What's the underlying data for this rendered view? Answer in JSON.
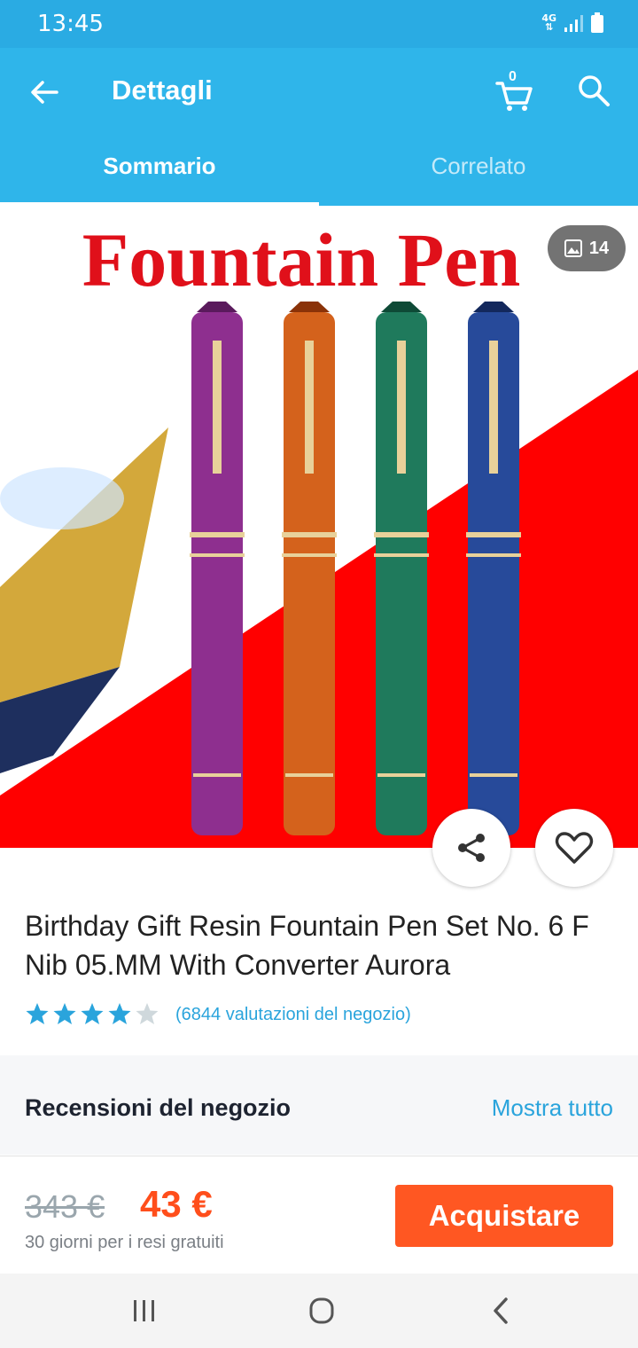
{
  "status_bar": {
    "time": "13:45",
    "network": "4G"
  },
  "header": {
    "title": "Dettagli",
    "cart_count": "0",
    "tabs": [
      {
        "label": "Sommario",
        "active": true
      },
      {
        "label": "Correlato",
        "active": false
      }
    ]
  },
  "gallery": {
    "banner_text": "Fountain Pen",
    "photo_count": "14",
    "pen_colors": [
      "#8e2f8f",
      "#d4621c",
      "#1f7a5c",
      "#274a9a"
    ]
  },
  "product": {
    "title": "Birthday Gift Resin Fountain Pen Set No. 6 F Nib 05.MM With Converter Aurora",
    "rating": 4.5,
    "rating_text": "(6844 valutazioni del negozio)"
  },
  "reviews": {
    "title": "Recensioni del negozio",
    "show_all": "Mostra tutto"
  },
  "purchase": {
    "old_price": "343 €",
    "price": "43 €",
    "returns": "30 giorni per i resi gratuiti",
    "buy_label": "Acquistare"
  },
  "colors": {
    "primary": "#2fb5ea",
    "accent": "#ff5722",
    "link": "#2aa4dc"
  }
}
